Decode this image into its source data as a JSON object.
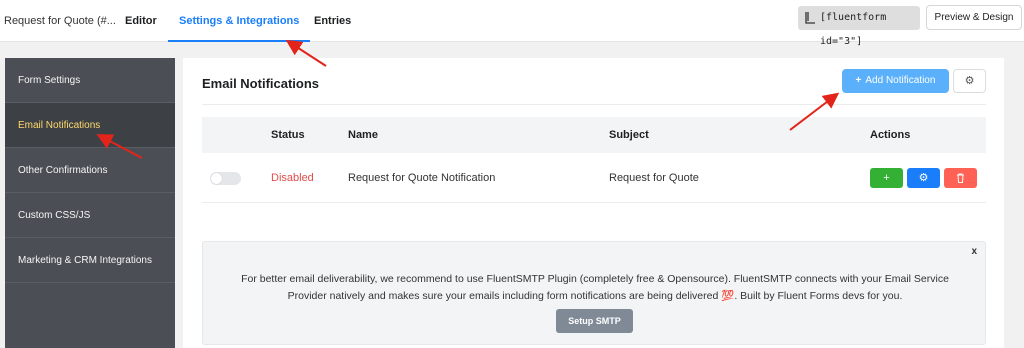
{
  "topbar": {
    "form_title": "Request for Quote (#...",
    "tabs": [
      "Editor",
      "Settings & Integrations",
      "Entries"
    ],
    "active_tab": "Settings & Integrations",
    "shortcode": "[fluentform id=\"3\"]",
    "preview_label": "Preview & Design"
  },
  "sidebar": {
    "items": [
      {
        "label": "Form Settings"
      },
      {
        "label": "Email Notifications"
      },
      {
        "label": "Other Confirmations"
      },
      {
        "label": "Custom CSS/JS"
      },
      {
        "label": "Marketing & CRM Integrations"
      }
    ],
    "active": "Email Notifications"
  },
  "panel": {
    "title": "Email Notifications",
    "add_label": "Add Notification",
    "table": {
      "headers": [
        "Status",
        "Name",
        "Subject",
        "Actions"
      ],
      "rows": [
        {
          "status": "Disabled",
          "name": "Request for Quote Notification",
          "subject": "Request for Quote",
          "enabled": false
        }
      ],
      "actions": [
        {
          "icon": "plus-icon",
          "label": "+"
        },
        {
          "icon": "gear-icon",
          "label": "⚙"
        },
        {
          "icon": "trash-icon",
          "label": "🗑"
        }
      ]
    },
    "notice": {
      "close": "x",
      "text": "For better email deliverability, we recommend to use FluentSMTP Plugin (completely free & Opensource). FluentSMTP connects with your Email Service Provider natively and makes sure your emails including form notifications are being delivered 💯. Built by Fluent Forms devs for you.",
      "button": "Setup SMTP"
    }
  },
  "colors": {
    "accent": "#1a7efb",
    "sidebar_bg": "#4b4f55",
    "sidebar_active_text": "#ffd86b",
    "status_disabled": "#e24c4b",
    "annotation_arrow": "#e3241b"
  }
}
